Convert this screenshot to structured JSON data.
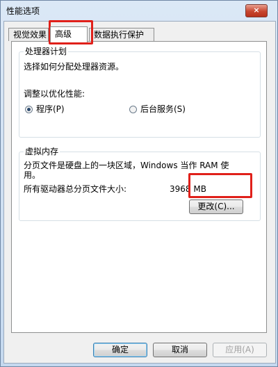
{
  "window": {
    "title": "性能选项",
    "close_glyph": "×"
  },
  "tabs": [
    {
      "label": "视觉效果"
    },
    {
      "label": "高级"
    },
    {
      "label": "数据执行保护"
    }
  ],
  "processor_group": {
    "title": "处理器计划",
    "description": "选择如何分配处理器资源。",
    "adjust_label": "调整以优化性能:",
    "option_programs": "程序(P)",
    "option_background": "后台服务(S)",
    "selected": "程序(P)"
  },
  "virtual_memory_group": {
    "title": "虚拟内存",
    "description_line1": "分页文件是硬盘上的一块区域，Windows 当作 RAM 使",
    "description_line2": "用。",
    "total_label": "所有驱动器总分页文件大小:",
    "total_value": "3968 MB",
    "change_button": "更改(C)..."
  },
  "footer": {
    "ok": "确定",
    "cancel": "取消",
    "apply": "应用(A)"
  },
  "colors": {
    "highlight": "#e0201a",
    "titlebar": "#c5d9ef",
    "close_button": "#c7462f"
  }
}
